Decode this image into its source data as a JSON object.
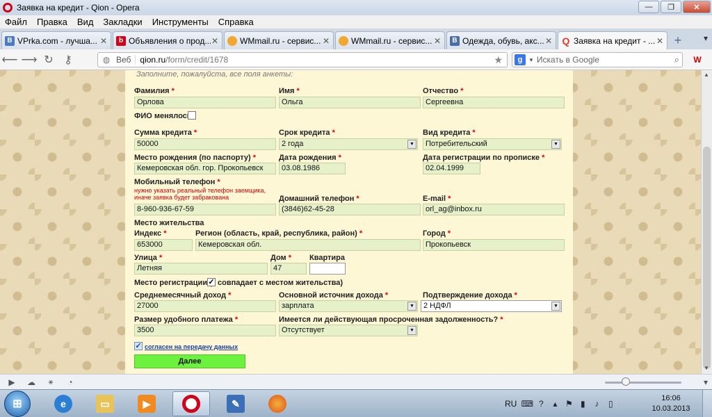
{
  "window": {
    "title": "Заявка на кредит - Qion - Opera"
  },
  "menu": [
    "Файл",
    "Правка",
    "Вид",
    "Закладки",
    "Инструменты",
    "Справка"
  ],
  "tabs": [
    {
      "label": "VPrka.com - лучша...",
      "icon_letter": "B",
      "icon_color": "#4a79c9"
    },
    {
      "label": "Объявления о прод...",
      "icon_letter": "b",
      "icon_color": "#d0021b"
    },
    {
      "label": "WMmail.ru - сервис...",
      "icon_letter": "",
      "icon_color": "#f0a830"
    },
    {
      "label": "WMmail.ru - сервис...",
      "icon_letter": "",
      "icon_color": "#f0a830"
    },
    {
      "label": "Одежда, обувь, акс...",
      "icon_letter": "B",
      "icon_color": "#4a6ea8"
    },
    {
      "label": "Заявка на кредит - ...",
      "icon_letter": "Q",
      "icon_color": "#e23b2a"
    }
  ],
  "address": {
    "badge": "Веб",
    "host": "qion.ru",
    "path": "/form/credit/1678"
  },
  "search": {
    "placeholder": "Искать в Google"
  },
  "form": {
    "hint": "Заполните, пожалуйста, все поля анкеты:",
    "lastname_label": "Фамилия",
    "lastname": "Орлова",
    "firstname_label": "Имя",
    "firstname": "Ольга",
    "patronymic_label": "Отчество",
    "patronymic": "Сергеевна",
    "name_changed_label": "ФИО менялось",
    "amount_label": "Сумма кредита",
    "amount": "50000",
    "term_label": "Срок кредита",
    "term": "2 года",
    "type_label": "Вид кредита",
    "type": "Потребительский",
    "birthplace_label": "Место рождения (по паспорту)",
    "birthplace": "Кемеровская  обл. гор. Прокопьевск",
    "birthdate_label": "Дата рождения",
    "birthdate": "03.08.1986",
    "regdate_label": "Дата регистрации по прописке",
    "regdate": "02.04.1999",
    "mobile_label": "Мобильный телефон",
    "mobile_note_1": "нужно указать реальный телефон заемщика,",
    "mobile_note_2": "иначе заявка будет забракована",
    "mobile": "8-960-936-67-59",
    "home_phone_label": "Домашний телефон",
    "home_phone": "(3846)62-45-28",
    "email_label": "E-mail",
    "email": "orl_ag@inbox.ru",
    "residence_label": "Место жительства",
    "index_label": "Индекс",
    "index": "653000",
    "region_label": "Регион (область, край, республика, район)",
    "region": "Кемеровская  обл.",
    "city_label": "Город",
    "city": "Прокопьевск",
    "street_label": "Улица",
    "street": "Летняя",
    "house_label": "Дом",
    "house": "47",
    "apartment_label": "Квартира",
    "apartment": "",
    "reg_place_label_1": "Место регистрации (",
    "reg_place_label_2": "совпадает с местом жительства)",
    "income_label": "Среднемесячный доход",
    "income": "27000",
    "income_source_label": "Основной источник дохода",
    "income_source": "зарплата",
    "income_proof_label": "Подтверждение дохода",
    "income_proof": "2 НДФЛ",
    "payment_label": "Размер удобного платежа",
    "payment": "3500",
    "debt_label": "Имеется ли действующая просроченная задолженность?",
    "debt": "Отсутствует",
    "consent_label": "согласен на передачу данных",
    "submit_label": "Далее",
    "required_mark": "*"
  },
  "taskbar": {
    "lang": "RU",
    "time": "16:06",
    "date": "10.03.2013"
  }
}
